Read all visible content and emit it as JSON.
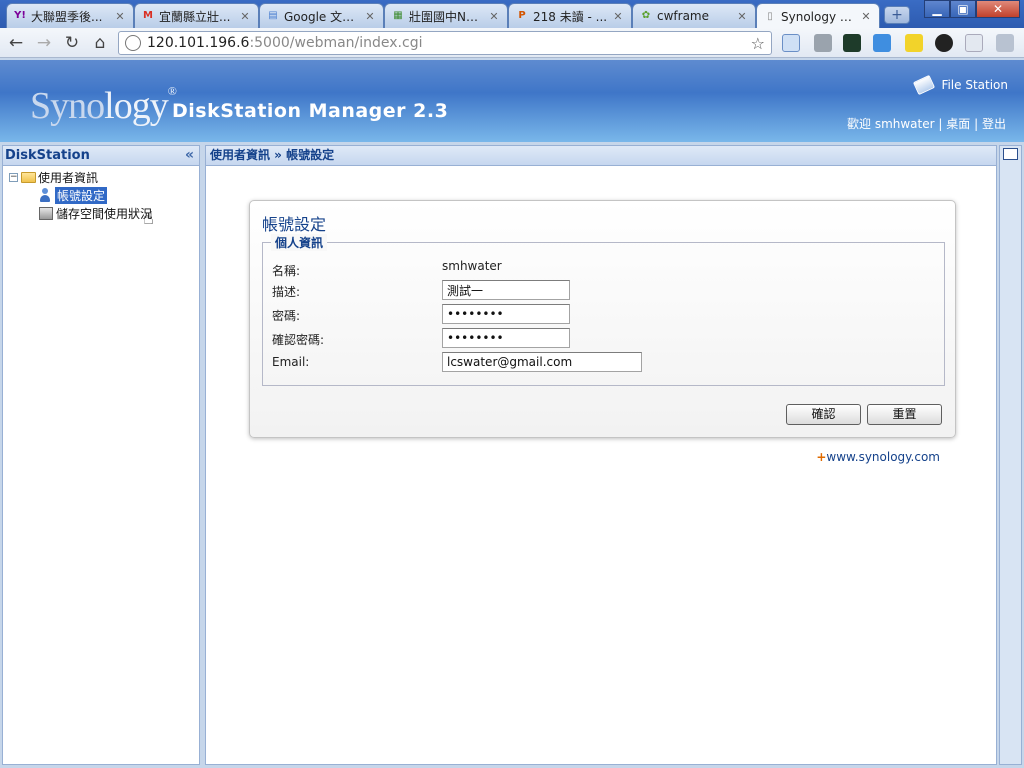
{
  "browser": {
    "tabs": [
      {
        "label": "大聯盟季後...",
        "fav": "Y!",
        "fav_color": "#7b0099",
        "active": false
      },
      {
        "label": "宜蘭縣立壯...",
        "fav": "M",
        "fav_color": "#d93025",
        "active": false
      },
      {
        "label": "Google 文件...",
        "fav": "▤",
        "fav_color": "#4a7fd0",
        "active": false
      },
      {
        "label": "壯圍國中NA...",
        "fav": "▦",
        "fav_color": "#3c8a2e",
        "active": false
      },
      {
        "label": "218 未讀 - ...",
        "fav": "P",
        "fav_color": "#d35400",
        "active": false
      },
      {
        "label": "cwframe",
        "fav": "✿",
        "fav_color": "#5aa02c",
        "active": false
      },
      {
        "label": "Synology Dis...",
        "fav": "▯",
        "fav_color": "#888888",
        "active": true
      }
    ],
    "close_glyph": "✕",
    "new_tab": "+",
    "window_buttons": {
      "minimize": "▁",
      "maximize": "▣",
      "close": "✕"
    },
    "nav": {
      "back": "←",
      "forward": "→",
      "reload": "↻",
      "home": "⌂"
    },
    "url_host": "120.101.196.6",
    "url_rest": ":5000/webman/index.cgi",
    "star": "☆"
  },
  "header": {
    "logo_a": "Syno",
    "logo_b": "logy",
    "logo_reg": "®",
    "product_title": "DiskStation Manager 2.3",
    "file_station": "File Station",
    "welcome": "歡迎 smhwater",
    "desktop": "桌面",
    "logout": "登出",
    "sep": "|"
  },
  "sidebar": {
    "title": "DiskStation",
    "collapse": "«",
    "tree": {
      "root_label": "使用者資訊",
      "root_toggle": "−",
      "children": [
        {
          "label": "帳號設定",
          "selected": true
        },
        {
          "label": "儲存空間使用狀況",
          "selected": false
        }
      ]
    },
    "cursor": "☝"
  },
  "main": {
    "breadcrumb": "使用者資訊 » 帳號設定",
    "card_title": "帳號設定",
    "legend": "個人資訊",
    "fields": {
      "name_label": "名稱:",
      "name_value": "smhwater",
      "desc_label": "描述:",
      "desc_value": "測試一",
      "password_label": "密碼:",
      "password_value": "password",
      "confirm_label": "確認密碼:",
      "confirm_value": "password",
      "email_label": "Email:",
      "email_value": "lcswater@gmail.com"
    },
    "confirm_button": "確認",
    "reset_button": "重置",
    "link_plus": "+",
    "link_text": "www.synology.com"
  }
}
